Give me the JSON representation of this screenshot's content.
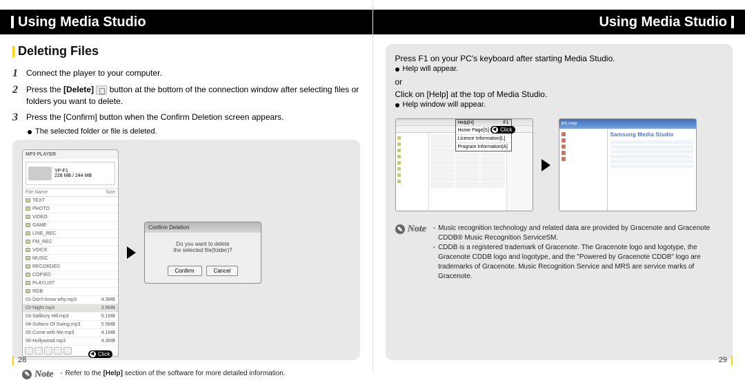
{
  "headers": {
    "left": "Using Media Studio",
    "right": "Using Media Studio"
  },
  "left_page": {
    "section_title": "Deleting Files",
    "steps": [
      {
        "num": "1",
        "text": "Connect the player to your computer."
      },
      {
        "num": "2",
        "pre": "Press the ",
        "bold": "[Delete]",
        "post": " button at the bottom of the connection window after selecting files or folders you want to delete."
      },
      {
        "num": "3",
        "text": "Press the [Confirm] button when the Confirm Deletion screen appears."
      }
    ],
    "sub_bullet": "The selected folder or file is deleted.",
    "mp3_panel": {
      "title": "MP3 PLAYER",
      "device": {
        "model": "YP-F1",
        "capacity": "228 MB / 244 MB"
      },
      "columns": {
        "name": "File Name",
        "size": "Size"
      },
      "folders": [
        "TEXT",
        "PHOTO",
        "VIDEO",
        "GAME",
        "LINE_REC",
        "FM_REC",
        "VOICE",
        "MUSIC",
        "RECORDED",
        "COPIED",
        "PLAYLIST",
        "RGB"
      ],
      "files": [
        {
          "name": "01-Don't know why.mp3",
          "size": "4.3MB"
        },
        {
          "name": "02-Night.mp3",
          "size": "3.9MB",
          "selected": true
        },
        {
          "name": "03-Salibury Hill.mp3",
          "size": "5.1MB"
        },
        {
          "name": "04-Sultans Of Swing.mp3",
          "size": "5.5MB"
        },
        {
          "name": "05-Come with Me.mp3",
          "size": "4.1MB"
        },
        {
          "name": "06-Hollywood.mp3",
          "size": "4.3MB"
        }
      ]
    },
    "dialog": {
      "title": "Confirm Deletion",
      "line1": "Do you want to delete",
      "line2": "the selected file(folder)?",
      "confirm": "Confirm",
      "cancel": "Cancel"
    },
    "click_label": "Click",
    "note_label": "Note",
    "note_text_pre": "Refer to the ",
    "note_text_bold": "[Help]",
    "note_text_post": " section of the software for more detailed information.",
    "page_number": "28"
  },
  "right_page": {
    "line1": "Press F1 on your PC's keyboard after starting Media Studio.",
    "bullet1": "Help will appear.",
    "or": "or",
    "line2": "Click on [Help] at the top of Media Studio.",
    "bullet2": "Help window will appear.",
    "help_popup": {
      "title_left": "Help[H]",
      "title_right": "F1",
      "items": [
        "Home Page[S]",
        "Licence Information[L]",
        "Program Information[A]"
      ]
    },
    "click_label": "Click",
    "help_window": {
      "title": "MS Help",
      "brand": "Samsung Media Studio"
    },
    "note_label": "Note",
    "notes": [
      "Music recognition technology and related data are provided by Gracenote and Gracenote CDDB® Music Recognition ServiceSM.",
      "CDDB is a registered trademark of Gracenote. The Gracenote logo and logotype, the Gracenote CDDB logo and logotype, and the \"Powered by Gracenote CDDB\" logo are trademarks of Gracenote. Music Recognition Service and MRS are service marks of Gracenote."
    ],
    "page_number": "29"
  }
}
